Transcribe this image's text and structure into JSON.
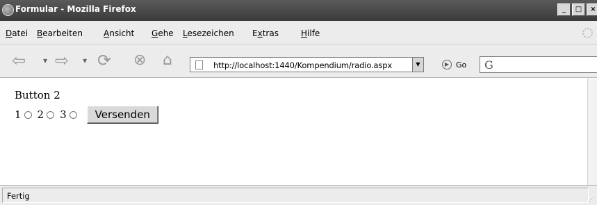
{
  "window": {
    "title": "Formular - Mozilla Firefox",
    "controls": {
      "minimize": "_",
      "maximize": "□",
      "close": "×"
    }
  },
  "menu": {
    "items": [
      {
        "accel": "D",
        "rest": "atei"
      },
      {
        "accel": "B",
        "rest": "earbeiten"
      },
      {
        "accel": "A",
        "rest": "nsicht"
      },
      {
        "accel": "G",
        "rest": "ehe"
      },
      {
        "accel": "L",
        "rest": "esezeichen"
      },
      {
        "pre": "E",
        "accel": "x",
        "rest": "tras"
      },
      {
        "accel": "H",
        "rest": "ilfe"
      }
    ]
  },
  "toolbar": {
    "url": "http://localhost:1440/Kompendium/radio.aspx",
    "go_label": "Go",
    "search_icon": "G",
    "icons": [
      "back-arrow-icon",
      "forward-arrow-icon",
      "reload-icon",
      "stop-icon",
      "home-icon"
    ]
  },
  "page": {
    "selected_text": "Button 2",
    "radios": [
      {
        "label": "1",
        "checked": false
      },
      {
        "label": "2",
        "checked": false
      },
      {
        "label": "3",
        "checked": false
      }
    ],
    "submit_label": "Versenden"
  },
  "status": {
    "text": "Fertig"
  }
}
